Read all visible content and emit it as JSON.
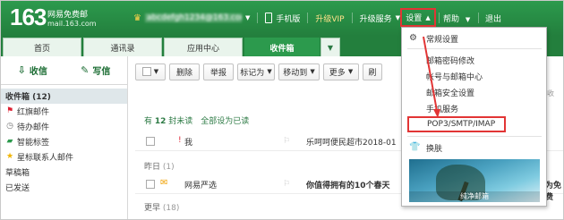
{
  "brand": {
    "logo_num": "163",
    "logo_cn": "网易免费邮",
    "logo_url": "mail.163.com"
  },
  "topbar": {
    "email": "abcdefgh1234@163.com",
    "mobile": "手机版",
    "vip": "升级VIP",
    "upgrade": "升级服务",
    "settings": "设置",
    "help": "帮助",
    "logout": "退出"
  },
  "tabs": [
    {
      "label": "首页"
    },
    {
      "label": "通讯录"
    },
    {
      "label": "应用中心"
    },
    {
      "label": "收件箱"
    }
  ],
  "left": {
    "receive": "收信",
    "write": "写信",
    "items": [
      {
        "label": "收件箱 (12)",
        "icon": "inbox"
      },
      {
        "label": "红旗邮件",
        "icon": "red-flag"
      },
      {
        "label": "待办邮件",
        "icon": "clock"
      },
      {
        "label": "智能标签",
        "icon": "tag"
      },
      {
        "label": "星标联系人邮件",
        "icon": "star"
      },
      {
        "label": "草稿箱",
        "icon": ""
      },
      {
        "label": "已发送",
        "icon": ""
      },
      {
        "label": "",
        "icon": ""
      }
    ]
  },
  "toolbar": {
    "delete": "删除",
    "report": "举报",
    "mark": "标记为",
    "move": "移动到",
    "more": "更多",
    "refresh": "刷",
    "right_text": "广告诉收"
  },
  "list": {
    "unread_prefix": "有",
    "unread_count": "12",
    "unread_suffix": "封未读",
    "mark_all": "全部设为已读",
    "rows": [
      {
        "sender": "我",
        "subject": "乐呵呵便民超市2018-01"
      },
      {
        "sender": "网易严选",
        "subject": "你值得拥有的10个春天"
      }
    ],
    "groups": [
      {
        "label": "昨日",
        "count": "(1)"
      },
      {
        "label": "更早",
        "count": "(18)"
      }
    ],
    "row2_extra": "为免费"
  },
  "menu": {
    "items": [
      {
        "label": "常规设置",
        "icon": "gear"
      },
      {
        "label": "邮箱密码修改",
        "icon": ""
      },
      {
        "label": "帐号与邮箱中心",
        "icon": ""
      },
      {
        "label": "邮箱安全设置",
        "icon": ""
      },
      {
        "label": "手机服务",
        "icon": ""
      },
      {
        "label": "POP3/SMTP/IMAP",
        "icon": ""
      },
      {
        "label": "换肤",
        "icon": "tshirt"
      }
    ],
    "theme_caption": "纯净邮箱"
  },
  "colors": {
    "green": "#2c9a4d",
    "dark_green": "#237f3d",
    "red": "#e23535"
  }
}
